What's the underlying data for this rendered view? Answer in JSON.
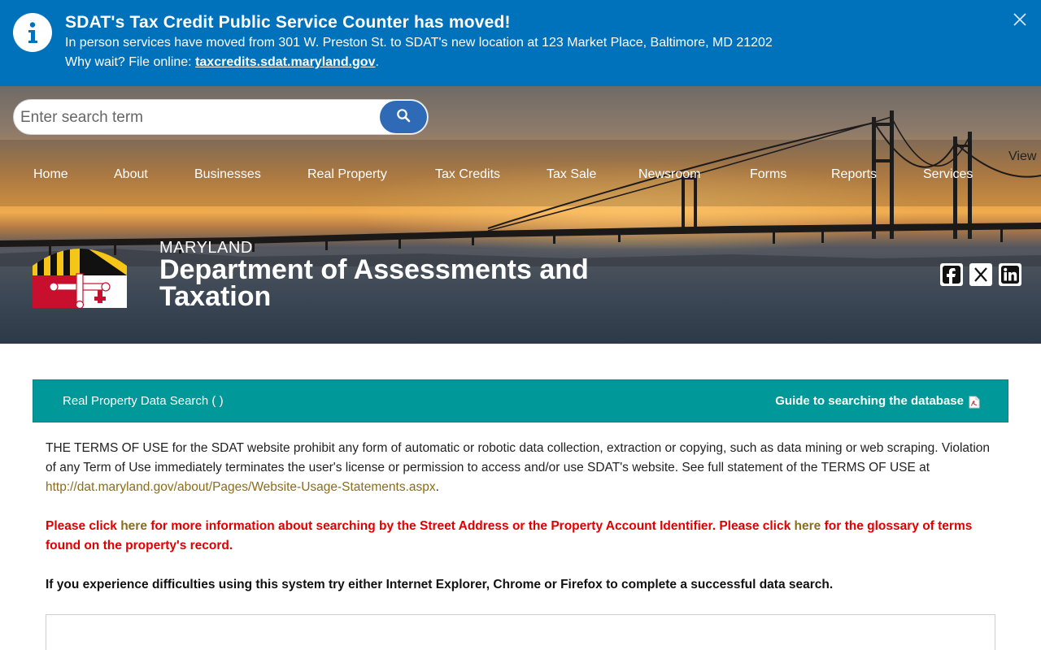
{
  "alert": {
    "title": "SDAT's Tax Credit Public Service Counter has moved!",
    "line1": "In person services have moved from 301 W. Preston St. to SDAT's new location at 123 Market Place, Baltimore, MD 21202",
    "line2_prefix": "Why wait? File online: ",
    "line2_link": "taxcredits.sdat.maryland.gov",
    "line2_suffix": ".",
    "icon": "info-icon",
    "close_icon": "close-icon",
    "color": "#0072bb"
  },
  "search": {
    "placeholder": "Enter search term",
    "value": "",
    "button_icon": "search-icon",
    "button_color": "#2f6ab7"
  },
  "nav": {
    "items": [
      "Home",
      "About",
      "Businesses",
      "Real Property",
      "Tax Credits",
      "Tax Sale",
      "Newsroom",
      "Forms",
      "Reports",
      "Services"
    ],
    "view_label": "View"
  },
  "brand": {
    "state": "MARYLAND",
    "name": "Department of Assessments and Taxation",
    "logo": "maryland-flag-logo"
  },
  "social": [
    "facebook-icon",
    "x-twitter-icon",
    "linkedin-icon"
  ],
  "bar": {
    "title": "Real Property Data Search ( )",
    "guide": "Guide to searching the database",
    "guide_icon": "pdf-icon",
    "color": "#009898"
  },
  "content": {
    "terms_text": "THE TERMS OF USE for the SDAT website prohibit any form of automatic or robotic data collection, extraction or copying, such as data mining or web scraping. Violation of any Term of Use immediately terminates the user's license or permission to access and/or use SDAT's website. See full statement of the TERMS OF USE at ",
    "terms_link": "http://dat.maryland.gov/about/Pages/Website-Usage-Statements.aspx",
    "terms_suffix": ".",
    "red_1": "Please click ",
    "red_here1": "here",
    "red_2": " for more information about searching by the Street Address or the Property Account Identifier. Please click ",
    "red_here2": "here",
    "red_3": " for the glossary of terms found on the property's record.",
    "browser_note": "If you experience difficulties using this system try either Internet Explorer, Chrome or Firefox to complete a successful data search.",
    "red_color": "#e00000",
    "link_color": "#8a6d1c"
  }
}
